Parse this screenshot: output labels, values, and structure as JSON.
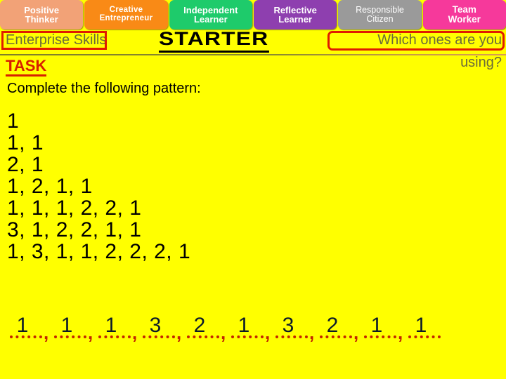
{
  "page": {
    "background_color": "#FFFF00"
  },
  "header": {
    "tabs": [
      {
        "name": "positive-thinker",
        "line1": "Positive",
        "line2": "Thinker",
        "color": "#F2A277"
      },
      {
        "name": "creative-entrepreneur",
        "line1": "Creative",
        "line2": "Entrepreneur",
        "color": "#F98A16"
      },
      {
        "name": "independent-learner",
        "line1": "Independent",
        "line2": "Learner",
        "color": "#1ECB6B"
      },
      {
        "name": "reflective-learner",
        "line1": "Reflective",
        "line2": "Learner",
        "color": "#8E3FAF"
      },
      {
        "name": "responsible-citizen",
        "line1": "Responsible",
        "line2": "Citizen",
        "color": "#9A9A9A"
      },
      {
        "name": "team-worker",
        "line1": "Team",
        "line2": "Worker",
        "color": "#F6399B"
      }
    ]
  },
  "subtitle": {
    "enterprise_skills": "Enterprise Skills",
    "starter": "STARTER",
    "question_line1": "Which ones are you",
    "question_line2": "using?",
    "highlight_color": "#E01B00",
    "text_color": "#6B6B3A"
  },
  "task": {
    "label": "TASK",
    "label_color": "#D81F00",
    "instruction": "Complete the following pattern:"
  },
  "sequence": {
    "lines": [
      "1",
      "1, 1",
      "2, 1",
      "1, 2, 1, 1",
      "1, 1, 1, 2, 2, 1",
      "3, 1, 2, 2, 1, 1",
      "1, 3, 1, 1, 2, 2, 2, 1"
    ]
  },
  "answer_row": {
    "numbers": [
      "1",
      "1",
      "1",
      "3",
      "2",
      "1",
      "3",
      "2",
      "1",
      "1"
    ],
    "separator": ",",
    "blank_color": "#C22400",
    "number_color": "#0A1A2A"
  }
}
